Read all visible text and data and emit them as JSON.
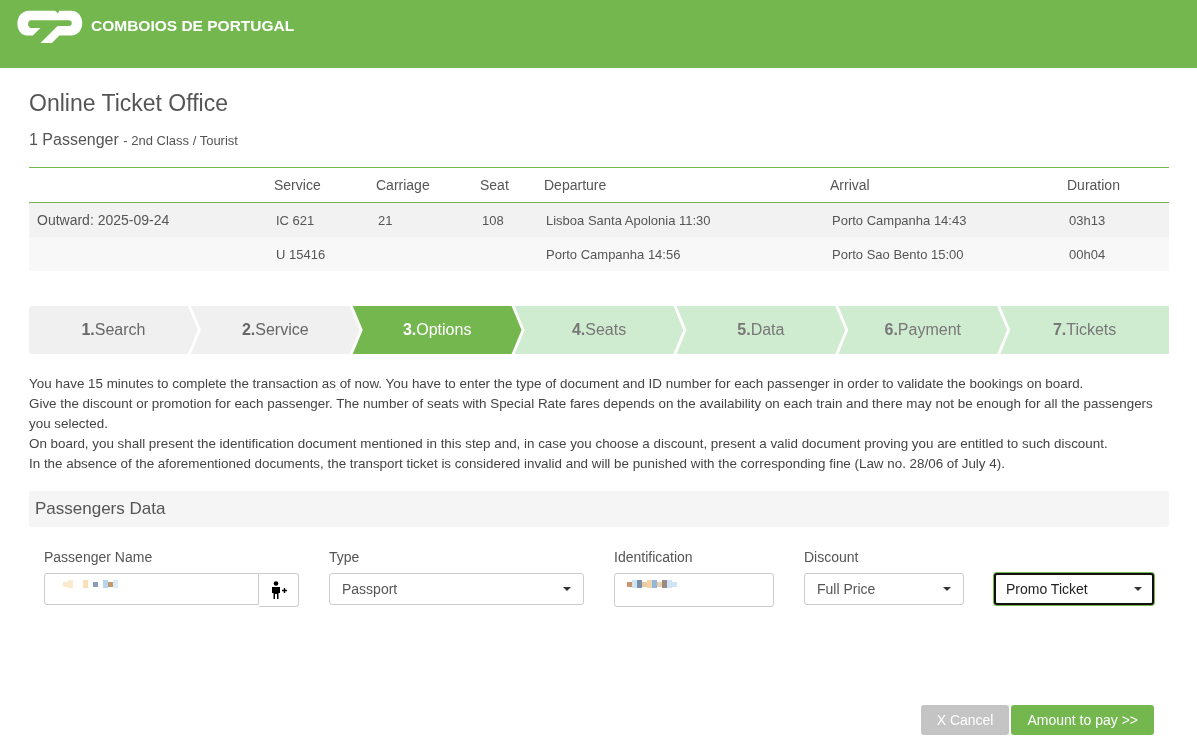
{
  "header": {
    "brand": "COMBOIOS DE PORTUGAL"
  },
  "page": {
    "title": "Online Ticket Office",
    "passengers": "1 Passenger",
    "class": "- 2nd Class / Tourist"
  },
  "trip_table": {
    "columns": [
      "",
      "Service",
      "Carriage",
      "Seat",
      "Departure",
      "Arrival",
      "Duration"
    ],
    "rows": [
      [
        "Outward: 2025-09-24",
        "IC 621",
        "21",
        "108",
        "Lisboa Santa Apolonia 11:30",
        "Porto Campanha 14:43",
        "03h13"
      ],
      [
        "",
        "U 15416",
        "",
        "",
        "Porto Campanha 14:56",
        "Porto Sao Bento 15:00",
        "00h04"
      ]
    ]
  },
  "steps": [
    {
      "label": "**1.**Search",
      "selected": false,
      "completed": true
    },
    {
      "label": "**2.**Service",
      "selected": false,
      "completed": true
    },
    {
      "label": "**3.**Options",
      "selected": true,
      "completed": false
    },
    {
      "label": "**4.**Seats",
      "selected": false,
      "completed": false
    },
    {
      "label": "**5.**Data",
      "selected": false,
      "completed": false
    },
    {
      "label": "**6.**Payment",
      "selected": false,
      "completed": false
    },
    {
      "label": "**7.**Tickets",
      "selected": false,
      "completed": false
    }
  ],
  "notice": [
    "You have 15 minutes to complete the transaction as of now. You have to enter the type of document and ID number for each passenger in order to validate the bookings on board.",
    "Give the discount or promotion for each passenger. The number of seats with Special Rate fares depends on the availability on each train and there may not be enough for all the passengers you selected.",
    "On board, you shall present the identification document mentioned in this step and, in case you choose a discount, present a valid document proving you are entitled to such discount.",
    "In the absence of the aforementioned documents, the transport ticket is considered invalid and will be punished with the corresponding fine (Law no. 28/06 of July 4)."
  ],
  "passengers_section": {
    "title": "Passengers Data",
    "fields": [
      {
        "kind": "name",
        "label": "Passenger Name",
        "focused": false
      },
      {
        "kind": "select",
        "label": "Type",
        "value": "Passport",
        "focused": false
      },
      {
        "kind": "id",
        "label": "Identification",
        "focused": false
      },
      {
        "kind": "select",
        "label": "Discount",
        "value": "Full Price",
        "focused": false
      },
      {
        "kind": "select",
        "value": "Promo Ticket",
        "focused": true
      }
    ]
  },
  "buttons": [
    {
      "kind": "cancel",
      "label": "X Cancel"
    },
    {
      "kind": "primary",
      "label": "Amount to pay >>"
    }
  ]
}
